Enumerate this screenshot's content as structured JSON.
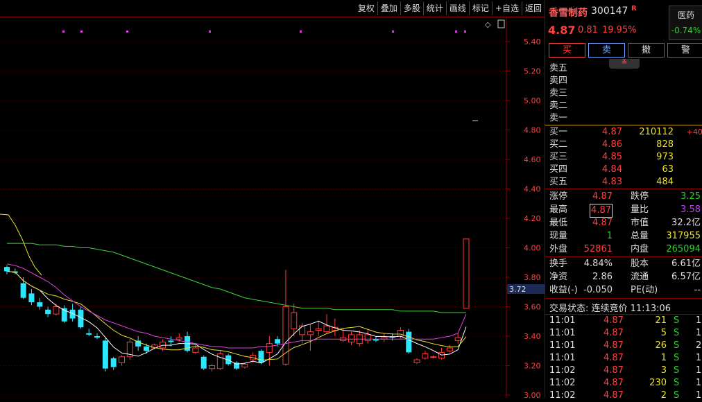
{
  "toolbar": [
    "复权",
    "叠加",
    "多股",
    "统计",
    "画线",
    "标记",
    "+自选",
    "返回"
  ],
  "stock": {
    "name": "香雪制药",
    "code": "300147",
    "flag": "R",
    "price": "4.87",
    "change": "0.81",
    "pct": "19.95%"
  },
  "industry": {
    "name": "医药",
    "change": "-0.74%"
  },
  "buttons": {
    "buy": "买",
    "sell": "卖",
    "cancel": "撤",
    "alert": "警"
  },
  "expander": "≚",
  "asks": [
    {
      "label": "卖五",
      "price": "",
      "vol": ""
    },
    {
      "label": "卖四",
      "price": "",
      "vol": ""
    },
    {
      "label": "卖三",
      "price": "",
      "vol": ""
    },
    {
      "label": "卖二",
      "price": "",
      "vol": ""
    },
    {
      "label": "卖一",
      "price": "",
      "vol": ""
    }
  ],
  "bids": [
    {
      "label": "买一",
      "price": "4.87",
      "vol": "210112",
      "extra": "+40"
    },
    {
      "label": "买二",
      "price": "4.86",
      "vol": "828",
      "extra": ""
    },
    {
      "label": "买三",
      "price": "4.85",
      "vol": "973",
      "extra": ""
    },
    {
      "label": "买四",
      "price": "4.84",
      "vol": "63",
      "extra": ""
    },
    {
      "label": "买五",
      "price": "4.83",
      "vol": "484",
      "extra": ""
    }
  ],
  "stats1": [
    {
      "l1": "涨停",
      "v1": "4.87",
      "l2": "跌停",
      "v2": "3.25",
      "c2": "#27d427",
      "boxed": false
    },
    {
      "l1": "最高",
      "v1": "4.87",
      "l2": "量比",
      "v2": "3.58",
      "c2": "#c040ff",
      "boxed": true
    },
    {
      "l1": "最低",
      "v1": "4.87",
      "l2": "市值",
      "v2": "32.2亿",
      "c2": "#ddd",
      "boxed": false
    },
    {
      "l1": "现量",
      "v1": "1",
      "l2": "总量",
      "v2": "317955",
      "c2": "#e8e035",
      "boxed": false,
      "c1": "#27d427"
    },
    {
      "l1": "外盘",
      "v1": "52861",
      "l2": "内盘",
      "v2": "265094",
      "c2": "#27d427",
      "boxed": false
    }
  ],
  "stats2": [
    {
      "l1": "换手",
      "v1": "4.84%",
      "l2": "股本",
      "v2": "6.61亿"
    },
    {
      "l1": "净资",
      "v1": "2.86",
      "l2": "流通",
      "v2": "6.57亿"
    },
    {
      "l1": "收益(-)",
      "v1": "-0.050",
      "l2": "PE(动)",
      "v2": "--"
    }
  ],
  "trade_status": "交易状态: 连续竞价 11:13:06",
  "ticks": [
    {
      "time": "11:01",
      "price": "4.87",
      "vol": "21",
      "side": "S",
      "n": "1"
    },
    {
      "time": "11:01",
      "price": "4.87",
      "vol": "5",
      "side": "S",
      "n": "1"
    },
    {
      "time": "11:01",
      "price": "4.87",
      "vol": "26",
      "side": "S",
      "n": "2"
    },
    {
      "time": "11:01",
      "price": "4.87",
      "vol": "1",
      "side": "S",
      "n": "1"
    },
    {
      "time": "11:02",
      "price": "4.87",
      "vol": "3",
      "side": "S",
      "n": "1"
    },
    {
      "time": "11:02",
      "price": "4.87",
      "vol": "230",
      "side": "S",
      "n": "1"
    },
    {
      "time": "11:02",
      "price": "4.87",
      "vol": "2",
      "side": "S",
      "n": "1"
    }
  ],
  "chart": {
    "axis_ticks": [
      "5.40",
      "5.20",
      "5.00",
      "4.80",
      "4.60",
      "4.40",
      "4.20",
      "4.00",
      "3.80",
      "3.60",
      "3.40",
      "3.20",
      "3.00"
    ],
    "cursor_label": "3.72",
    "colors": {
      "up": "#ff3c3c",
      "down": "#2be6ff",
      "ma5": "#ffffff",
      "ma10": "#e8e035",
      "ma20": "#e040e0",
      "ma60": "#3fd43f"
    }
  }
}
